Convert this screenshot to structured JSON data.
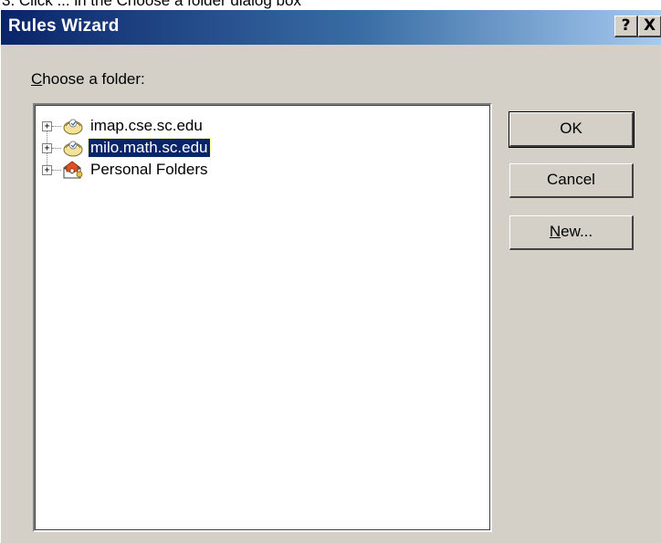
{
  "caption_fragment": "3. Click ... in the Choose a folder dialog box",
  "window": {
    "title": "Rules Wizard",
    "help_label": "?",
    "close_label": "X"
  },
  "folder_prompt": {
    "accesskey": "C",
    "rest": "hoose a folder:"
  },
  "tree": {
    "items": [
      {
        "label": "imap.cse.sc.edu",
        "icon": "mail-server-icon",
        "expander": "+",
        "selected": false
      },
      {
        "label": "milo.math.sc.edu",
        "icon": "mail-server-icon",
        "expander": "+",
        "selected": true
      },
      {
        "label": "Personal Folders",
        "icon": "personal-folders-icon",
        "expander": "+",
        "selected": false
      }
    ]
  },
  "buttons": {
    "ok": "OK",
    "cancel": "Cancel",
    "new_accesskey": "N",
    "new_rest": "ew..."
  },
  "colors": {
    "dialog_face": "#d4d0c8",
    "title_start": "#0a246a",
    "title_end": "#a6caf0",
    "selection": "#0a246a"
  }
}
